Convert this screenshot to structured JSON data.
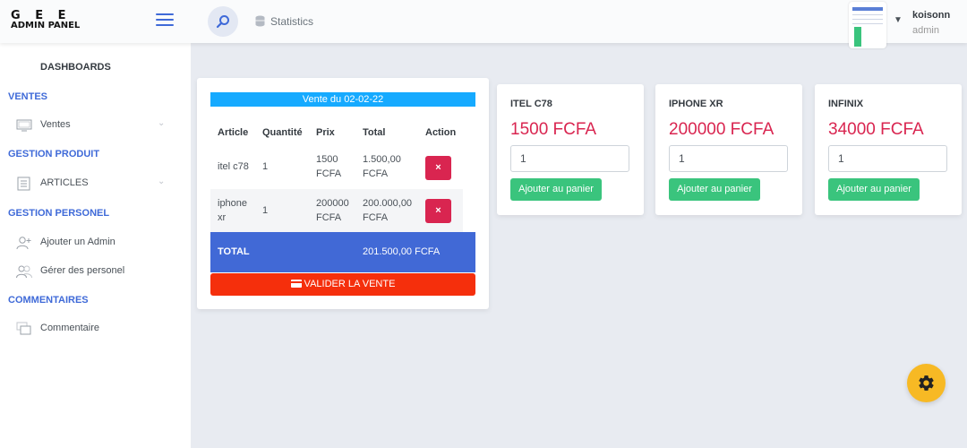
{
  "header": {
    "logo_line1": "G E E",
    "logo_line2": "ADMIN PANEL",
    "stats_label": "Statistics",
    "user_name": "koisonn",
    "user_role": "admin",
    "chevron_icon": "chevron-down-icon"
  },
  "sidebar": {
    "dashboards": "DASHBOARDS",
    "sections": [
      {
        "title": "VENTES",
        "items": [
          {
            "label": "Ventes",
            "icon": "monitor-icon",
            "has_caret": true
          }
        ]
      },
      {
        "title": "GESTION PRODUIT",
        "items": [
          {
            "label": "ARTICLES",
            "icon": "list-icon",
            "has_caret": true
          }
        ]
      },
      {
        "title": "GESTION PERSONEL",
        "items": [
          {
            "label": "Ajouter un Admin",
            "icon": "add-user-icon"
          },
          {
            "label": "Gérer des personel",
            "icon": "users-icon"
          }
        ]
      },
      {
        "title": "COMMENTAIRES",
        "items": [
          {
            "label": "Commentaire",
            "icon": "comment-icon"
          }
        ]
      }
    ]
  },
  "cart": {
    "title": "Vente du 02-02-22",
    "columns": [
      "Article",
      "Quantité",
      "Prix",
      "Total",
      "Action"
    ],
    "rows": [
      {
        "article": "itel c78",
        "quantite": "1",
        "prix_1": "1500",
        "prix_2": "FCFA",
        "total_1": "1.500,00",
        "total_2": "FCFA",
        "action": "×"
      },
      {
        "article_1": "iphone",
        "article_2": "xr",
        "quantite": "1",
        "prix_1": "200000",
        "prix_2": "FCFA",
        "total_1": "200.000,00",
        "total_2": "FCFA",
        "action": "×"
      }
    ],
    "total_label": "TOTAL",
    "total_value": "201.500,00 FCFA",
    "validate_label": "VALIDER LA VENTE"
  },
  "products": [
    {
      "name": "ITEL C78",
      "price": "1500 FCFA",
      "qty": "1",
      "button": "Ajouter au panier"
    },
    {
      "name": "IPHONE XR",
      "price": "200000 FCFA",
      "qty": "1",
      "button": "Ajouter au panier"
    },
    {
      "name": "INFINIX",
      "price": "34000 FCFA",
      "qty": "1",
      "button": "Ajouter au panier"
    }
  ],
  "colors": {
    "accent": "#3f6ad8",
    "danger": "#d92550",
    "success": "#3ac47d",
    "info": "#16aaff",
    "warning": "#f7b924",
    "validate": "#f52f0c"
  },
  "fab_icon": "gear-icon"
}
